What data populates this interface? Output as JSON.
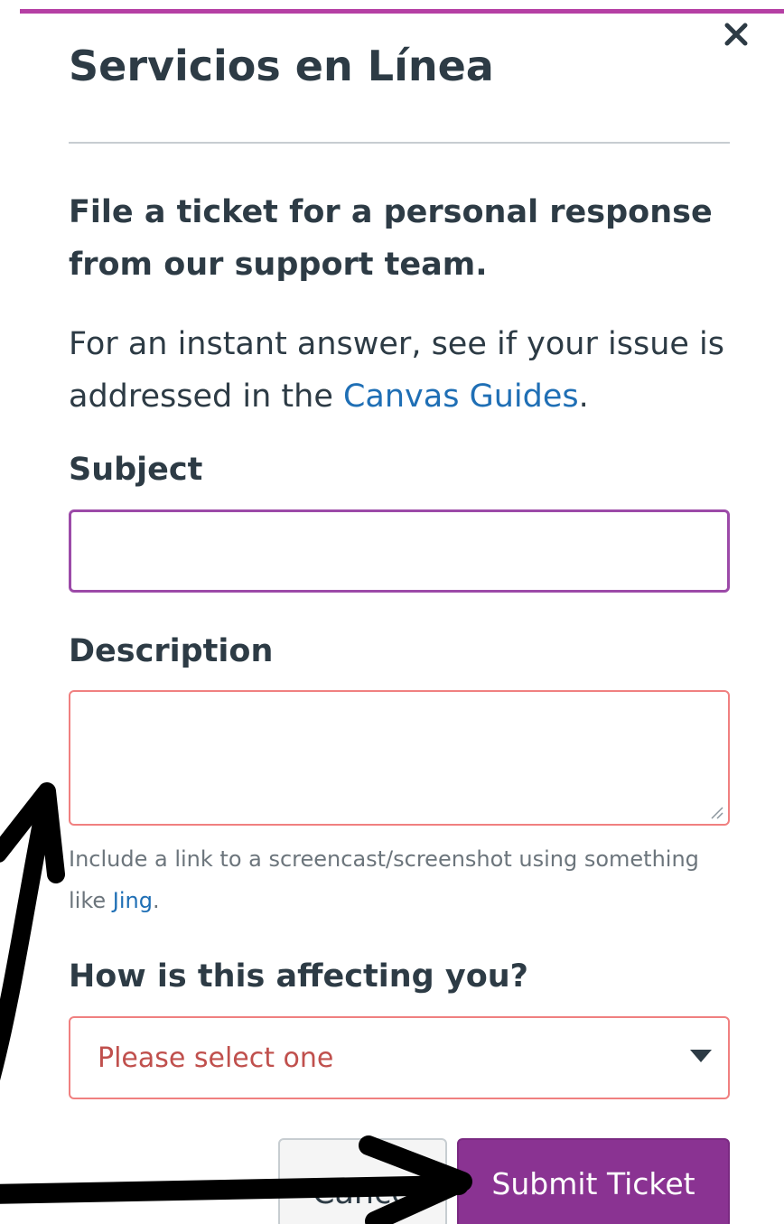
{
  "dialog": {
    "title": "Servicios en Línea",
    "close_icon": "close-icon",
    "intro_text": "File a ticket for a personal response from our support team.",
    "instant_prefix": "For an instant answer, see if your issue is addressed in the ",
    "instant_link": "Canvas Guides",
    "instant_suffix": "."
  },
  "form": {
    "subject": {
      "label": "Subject",
      "value": ""
    },
    "description": {
      "label": "Description",
      "value": "",
      "hint_prefix": "Include a link to a screencast/screenshot using something like ",
      "hint_link": "Jing",
      "hint_suffix": "."
    },
    "affecting": {
      "label": "How is this affecting you?",
      "selected": "Please select one"
    }
  },
  "buttons": {
    "cancel": "Cancel",
    "submit": "Submit Ticket"
  },
  "colors": {
    "accent": "#b53fa4",
    "submit_bg": "#8a3392",
    "link": "#1f6fb5",
    "error_border": "#f08080"
  }
}
